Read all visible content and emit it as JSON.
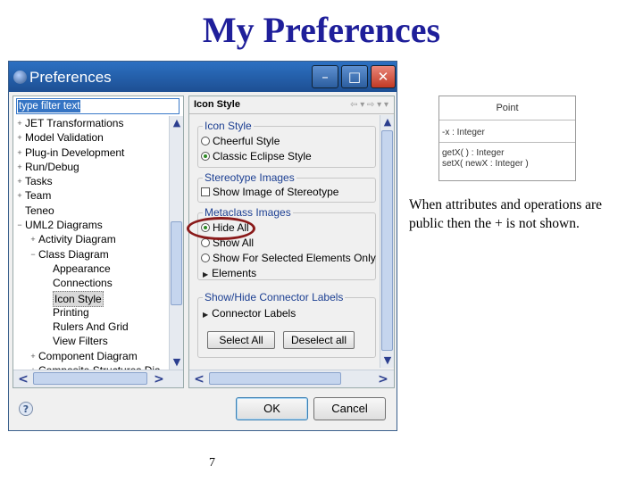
{
  "slide": {
    "title": "My Preferences",
    "caption": "When attributes and operations are public then the + is not shown.",
    "page_number": "7"
  },
  "uml": {
    "class_name": "Point",
    "attribute": "-x : Integer",
    "operations": [
      "getX( ) : Integer",
      "setX( newX : Integer )"
    ]
  },
  "window": {
    "title": "Preferences",
    "minimize_glyph": "–",
    "maximize_glyph": "□",
    "close_glyph": "✕",
    "filter_text": "type filter text",
    "tree": [
      {
        "label": "JET Transformations",
        "toggle": "+",
        "level": 0
      },
      {
        "label": "Model Validation",
        "toggle": "+",
        "level": 0
      },
      {
        "label": "Plug-in Development",
        "toggle": "+",
        "level": 0
      },
      {
        "label": "Run/Debug",
        "toggle": "+",
        "level": 0
      },
      {
        "label": "Tasks",
        "toggle": "+",
        "level": 0
      },
      {
        "label": "Team",
        "toggle": "+",
        "level": 0
      },
      {
        "label": "Teneo",
        "toggle": "",
        "level": 0
      },
      {
        "label": "UML2 Diagrams",
        "toggle": "−",
        "level": 0
      },
      {
        "label": "Activity Diagram",
        "toggle": "+",
        "level": 1
      },
      {
        "label": "Class Diagram",
        "toggle": "−",
        "level": 1
      },
      {
        "label": "Appearance",
        "toggle": "",
        "level": 2
      },
      {
        "label": "Connections",
        "toggle": "",
        "level": 2
      },
      {
        "label": "Icon Style",
        "toggle": "",
        "level": 2,
        "selected": true
      },
      {
        "label": "Printing",
        "toggle": "",
        "level": 2
      },
      {
        "label": "Rulers And Grid",
        "toggle": "",
        "level": 2
      },
      {
        "label": "View Filters",
        "toggle": "",
        "level": 2
      },
      {
        "label": "Component Diagram",
        "toggle": "+",
        "level": 1
      },
      {
        "label": "Composite Structures Dia",
        "toggle": "+",
        "level": 1
      }
    ],
    "page_title": "Icon Style",
    "page_tools": "⇦ ▾ ⇨ ▾ ▾",
    "icon_style": {
      "title": "Icon Style",
      "options": [
        "Cheerful Style",
        "Classic Eclipse Style"
      ]
    },
    "stereotype": {
      "title": "Stereotype Images",
      "checkbox": "Show Image of Stereotype"
    },
    "metaclass": {
      "title": "Metaclass Images",
      "options": [
        "Hide All",
        "Show All",
        "Show For Selected Elements Only"
      ],
      "elements": "Elements"
    },
    "connector": {
      "title": "Show/Hide Connector Labels",
      "labels": "Connector Labels",
      "select_all": "Select All",
      "deselect_all": "Deselect all"
    },
    "help": "?",
    "ok": "OK",
    "cancel": "Cancel"
  },
  "colors": {
    "title_text": "#1f1f9a",
    "titlebar": "#2c70c2",
    "highlight_ring": "#8a1a1a",
    "group_title": "#1c3f92"
  }
}
